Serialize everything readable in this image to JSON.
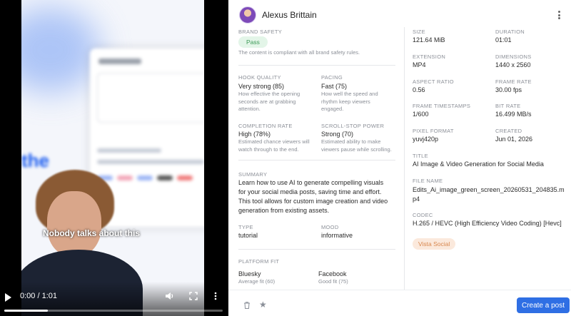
{
  "video": {
    "caption": "Nobody talks about this",
    "blurred_word": "the",
    "current_time": "0:00 / 1:01",
    "progress": 0.2
  },
  "header": {
    "username": "Alexus Brittain"
  },
  "brand_safety": {
    "label": "BRAND SAFETY",
    "badge": "Pass",
    "description": "The content is compliant with all brand safety rules."
  },
  "hook_quality": {
    "label": "HOOK QUALITY",
    "value": "Very strong (85)",
    "description": "How effective the opening seconds are at grabbing attention."
  },
  "pacing": {
    "label": "PACING",
    "value": "Fast (75)",
    "description": "How well the speed and rhythm keep viewers engaged."
  },
  "completion_rate": {
    "label": "COMPLETION RATE",
    "value": "High (78%)",
    "description": "Estimated chance viewers will watch through to the end."
  },
  "scroll_stop": {
    "label": "SCROLL-STOP POWER",
    "value": "Strong (70)",
    "description": "Estimated ability to make viewers pause while scrolling."
  },
  "summary": {
    "label": "SUMMARY",
    "text": "Learn how to use AI to generate compelling visuals for your social media posts, saving time and effort. This tool allows for custom image creation and video generation from existing assets."
  },
  "type": {
    "label": "TYPE",
    "value": "tutorial"
  },
  "mood": {
    "label": "MOOD",
    "value": "informative"
  },
  "platform_fit": {
    "label": "PLATFORM FIT",
    "items": [
      {
        "name": "Bluesky",
        "fit": "Average fit (60)"
      },
      {
        "name": "Facebook",
        "fit": "Good fit (75)"
      }
    ]
  },
  "meta": {
    "size": {
      "label": "SIZE",
      "value": "121.64 MiB"
    },
    "duration": {
      "label": "DURATION",
      "value": "01:01"
    },
    "extension": {
      "label": "EXTENSION",
      "value": "MP4"
    },
    "dimensions": {
      "label": "DIMENSIONS",
      "value": "1440 x 2560"
    },
    "aspect_ratio": {
      "label": "ASPECT RATIO",
      "value": "0.56"
    },
    "frame_rate": {
      "label": "FRAME RATE",
      "value": "30.00 fps"
    },
    "frame_timestamps": {
      "label": "FRAME TIMESTAMPS",
      "value": "1/600"
    },
    "bit_rate": {
      "label": "BIT RATE",
      "value": "16.499 MB/s"
    },
    "pixel_format": {
      "label": "PIXEL FORMAT",
      "value": "yuvj420p"
    },
    "created": {
      "label": "CREATED",
      "value": "Jun 01, 2026"
    },
    "title": {
      "label": "TITLE",
      "value": "AI Image & Video Generation for Social Media"
    },
    "file_name": {
      "label": "FILE NAME",
      "value": "Edits_Ai_image_green_screen_20260531_204835.mp4"
    },
    "codec": {
      "label": "CODEC",
      "value": "H.265 / HEVC (High Efficiency Video Coding) [Hevc]"
    }
  },
  "source_badge": "Vista Social",
  "footer": {
    "create_label": "Create a post"
  }
}
